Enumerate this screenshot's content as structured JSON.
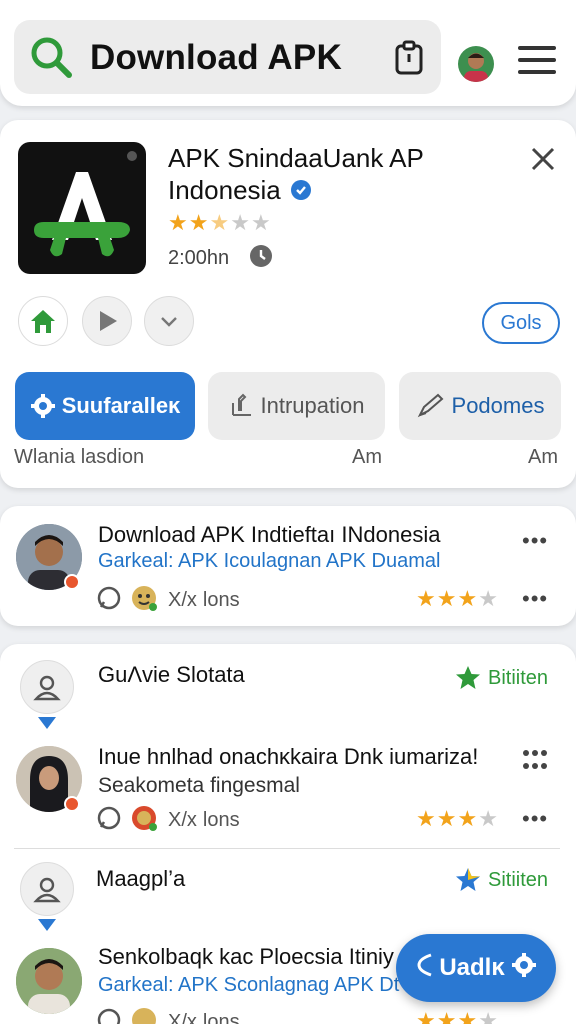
{
  "header": {
    "search_text": "Download APK"
  },
  "app_card": {
    "title": "APK SnindaaUank AP Indonesia",
    "rating_stars": 2.5,
    "rating_max": 5,
    "time": "2:00hn",
    "gols_label": "Gols",
    "actions": [
      {
        "label": "Suufaralleĸ"
      },
      {
        "label": "Intrupation"
      },
      {
        "label": "Podomes"
      }
    ],
    "footer_left": "Wlania lasdion",
    "footer_mid": "Am",
    "footer_right": "Am"
  },
  "post1": {
    "title": "Download APK Indtieftaı INdonesia",
    "subtitle": "Garkeal: APK Icoulagnan APK Duamal",
    "meta": "lons",
    "meta_prefix": "X/x",
    "stars": 3,
    "dots": "•••"
  },
  "group": {
    "header1": {
      "name": "GuΛvie Slotata",
      "badge": "Bitiiten"
    },
    "comment1": {
      "title": "Inue hnlhad onachĸkaira Dnk iumarizaǃ",
      "subtitle": "Seakometa fingesmal",
      "meta": "lons",
      "meta_prefix": "X/x",
      "stars": 3
    },
    "header2": {
      "name": "Maagpl’a",
      "badge": "Sitiiten"
    },
    "comment2": {
      "title": "Senkolbaqk kac Ploecsia Itiniy",
      "subtitle": "Garkeal: APK Sconlagnag APK Dt",
      "meta": "lons",
      "meta_prefix": "X/x",
      "stars": 3
    }
  },
  "fab": {
    "label": "Uadlĸ"
  },
  "colors": {
    "accent": "#2a78d2",
    "green": "#3aa23a",
    "star": "#f2a31b"
  }
}
